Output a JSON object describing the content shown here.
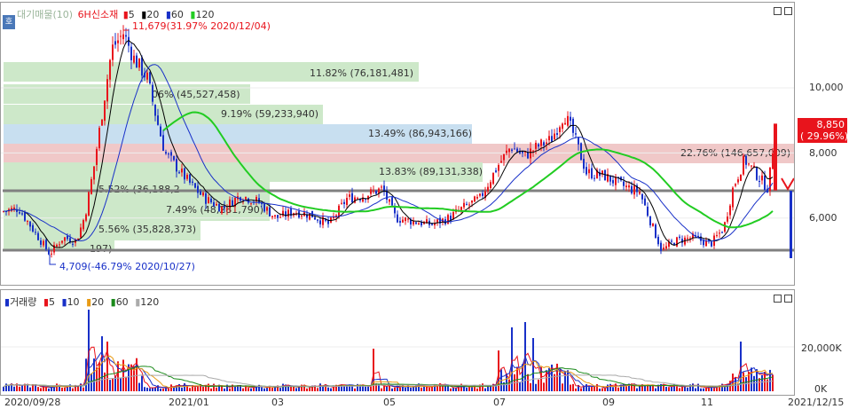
{
  "price_pane": {
    "legend": {
      "ticker_code": "대기매물(10)",
      "name": "6H신소재",
      "ma5": "5",
      "ma20": "20",
      "ma60": "60",
      "ma120": "120"
    },
    "side_tab": "호",
    "y_ticks": [
      "10,000",
      "8,000",
      "6,000"
    ],
    "current_price": "8,850",
    "current_change": "( 29.96%)",
    "high_annotation": "11,679(31.97% 2020/12/04)",
    "low_annotation": "4,709(-46.79% 2020/10/27)",
    "volume_bands": [
      {
        "label": "11.82% (76,181,481)",
        "color": "#cde8c9"
      },
      {
        "label": "06% (45,527,458)",
        "color": "#cde8c9"
      },
      {
        "label": "9.19% (59,233,940)",
        "color": "#cde8c9"
      },
      {
        "label": "13.49% (86,943,166)",
        "color": "#c8dff0"
      },
      {
        "label": "22.76% (146,657,009)",
        "color": "#f0c8c8"
      },
      {
        "label": "13.83% (89,131,338)",
        "color": "#cde8c9"
      },
      {
        "label": "5.52% (36,188,2",
        "color": "#cde8c9"
      },
      {
        "label": "7.49% (48,281,790)",
        "color": "#cde8c9"
      },
      {
        "label": "5.56% (35,828,373)",
        "color": "#cde8c9"
      },
      {
        "label": "197)",
        "color": "#cde8c9"
      }
    ]
  },
  "volume_pane": {
    "legend": {
      "title": "거래량",
      "ma5": "5",
      "ma10": "10",
      "ma20": "20",
      "ma60": "60",
      "ma120": "120"
    },
    "y_ticks": [
      "20,000K",
      "0K"
    ]
  },
  "x_axis": [
    "2020/09/28",
    "2021/01",
    "03",
    "05",
    "07",
    "09",
    "11",
    "2021/12/15"
  ],
  "colors": {
    "up": "#e8141c",
    "down": "#1830c8",
    "ma5": "#e8141c",
    "ma20": "#000000",
    "ma60": "#1830c8",
    "ma120": "#22cc22",
    "support": "#808080"
  }
}
